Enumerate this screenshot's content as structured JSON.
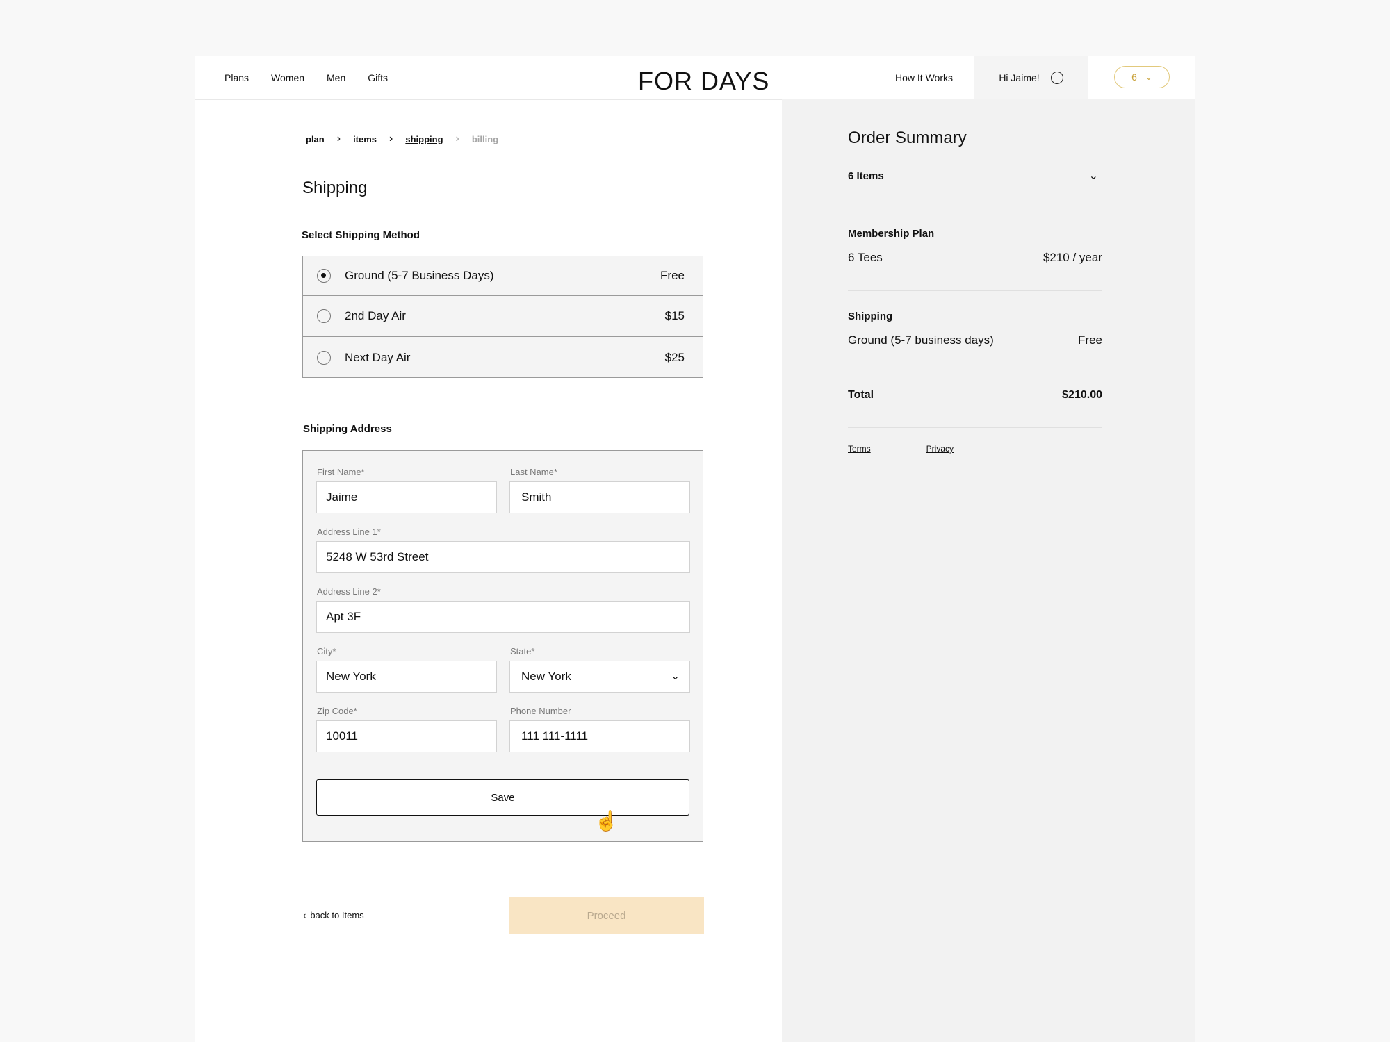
{
  "nav": {
    "links": [
      "Plans",
      "Women",
      "Men",
      "Gifts"
    ],
    "logo": "FOR DAYS",
    "how_it_works": "How It Works",
    "greeting": "Hi Jaime!",
    "cart_count": "6",
    "accent_color": "#c9a23a"
  },
  "breadcrumb": [
    "plan",
    "items",
    "shipping",
    "billing"
  ],
  "page_title": "Shipping",
  "shipping_method": {
    "title": "Select Shipping Method",
    "options": [
      {
        "label": "Ground (5-7 Business Days)",
        "price": "Free",
        "selected": true
      },
      {
        "label": "2nd Day Air",
        "price": "$15",
        "selected": false
      },
      {
        "label": "Next Day Air",
        "price": "$25",
        "selected": false
      }
    ]
  },
  "address": {
    "title": "Shipping Address",
    "first_name": {
      "label": "First Name*",
      "value": "Jaime"
    },
    "last_name": {
      "label": "Last Name*",
      "value": "Smith"
    },
    "line1": {
      "label": "Address Line 1*",
      "value": "5248 W 53rd Street"
    },
    "line2": {
      "label": "Address Line 2*",
      "value": "Apt 3F"
    },
    "city": {
      "label": "City*",
      "value": "New York"
    },
    "state": {
      "label": "State*",
      "value": "New York"
    },
    "zip": {
      "label": "Zip Code*",
      "value": "10011"
    },
    "phone": {
      "label": "Phone Number",
      "value": "111 111-1111"
    },
    "save": "Save"
  },
  "footer": {
    "back": "back to Items",
    "proceed": "Proceed"
  },
  "summary": {
    "title": "Order Summary",
    "items": "6 Items",
    "plan_head": "Membership Plan",
    "plan_name": "6 Tees",
    "plan_price": "$210 / year",
    "ship_head": "Shipping",
    "ship_name": "Ground (5-7 business days)",
    "ship_price": "Free",
    "total_label": "Total",
    "total_value": "$210.00",
    "terms": "Terms",
    "privacy": "Privacy"
  }
}
